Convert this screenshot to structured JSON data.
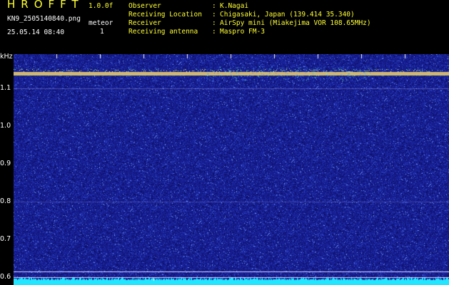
{
  "header": {
    "app_title": "HROFFT",
    "version": "1.0.0f",
    "filename": "KN9_2505140840.png",
    "datetime": "25.05.14 08:40",
    "meteor_label": "meteor",
    "meteor_count": "1"
  },
  "metadata": [
    {
      "label": "Observer",
      "value": "K.Nagai"
    },
    {
      "label": "Receiving Location",
      "value": "Chigasaki, Japan (139.414 35.340)"
    },
    {
      "label": "Receiver",
      "value": "AirSpy mini (Miakejima VOR 108.65MHz)"
    },
    {
      "label": "Receiving antenna",
      "value": "Maspro FM-3"
    }
  ],
  "chart_data": {
    "type": "heatmap",
    "ylabel": "kHz",
    "yticks": [
      "1.1",
      "1.0",
      "0.9",
      "0.8",
      "0.7",
      "0.6"
    ],
    "ytick_values": [
      1.1,
      1.0,
      0.9,
      0.8,
      0.7,
      0.6
    ],
    "xticks": [
      "0841",
      "0842",
      "0843",
      "0844",
      "0845",
      "0846",
      "0847",
      "0848",
      "0849",
      "0850"
    ],
    "xlim": [
      "0840",
      "0850"
    ],
    "ylim": [
      0.58,
      1.19
    ],
    "signals": [
      {
        "name": "carrier",
        "freq_khz": 1.14,
        "intensity": 1.0
      },
      {
        "name": "faint-line",
        "freq_khz": 1.1,
        "intensity": 0.35
      },
      {
        "name": "faint-line",
        "freq_khz": 0.8,
        "intensity": 0.25
      },
      {
        "name": "baseline-line",
        "freq_khz": 0.615,
        "intensity": 0.6
      },
      {
        "name": "baseline-line",
        "freq_khz": 0.6,
        "intensity": 0.45
      }
    ],
    "colors": {
      "background": "#1a1a8c",
      "noise": "#3a5ad0",
      "signal": "#ffff66",
      "hot": "#ff3333",
      "baseline": "#33ccff"
    }
  }
}
